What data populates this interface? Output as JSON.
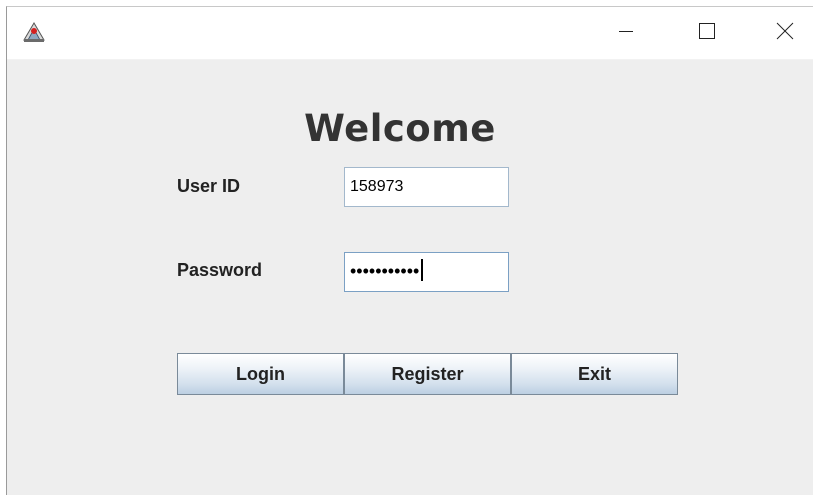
{
  "window": {
    "title": "",
    "icons": {
      "app": "java-app-icon",
      "minimize": "minimize-icon",
      "maximize": "maximize-icon",
      "close": "close-icon"
    }
  },
  "form": {
    "heading": "Welcome",
    "user_id_label": "User ID",
    "user_id_value": "158973",
    "password_label": "Password",
    "password_masked": "•••••••••••"
  },
  "buttons": {
    "login": "Login",
    "register": "Register",
    "exit": "Exit"
  },
  "colors": {
    "background": "#eeeeee",
    "field_border": "#7ba0c4",
    "button_gradient_bottom": "#bccfe2"
  }
}
